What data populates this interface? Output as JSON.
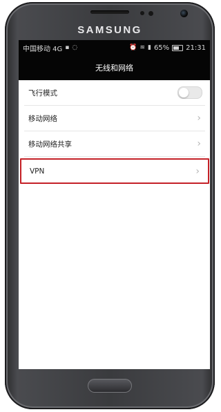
{
  "device": {
    "brand": "SAMSUNG"
  },
  "statusbar": {
    "carrier": "中国移动 4G",
    "battery_percent": "65%",
    "time": "21:31",
    "battery_level": 0.65
  },
  "header": {
    "title": "无线和网络"
  },
  "settings": {
    "items": [
      {
        "label": "飞行模式",
        "control": "toggle",
        "on": false
      },
      {
        "label": "移动网络",
        "control": "chevron"
      },
      {
        "label": "移动网络共享",
        "control": "chevron"
      },
      {
        "label": "VPN",
        "control": "chevron",
        "highlighted": true,
        "highlight_color": "#c42026"
      }
    ]
  }
}
